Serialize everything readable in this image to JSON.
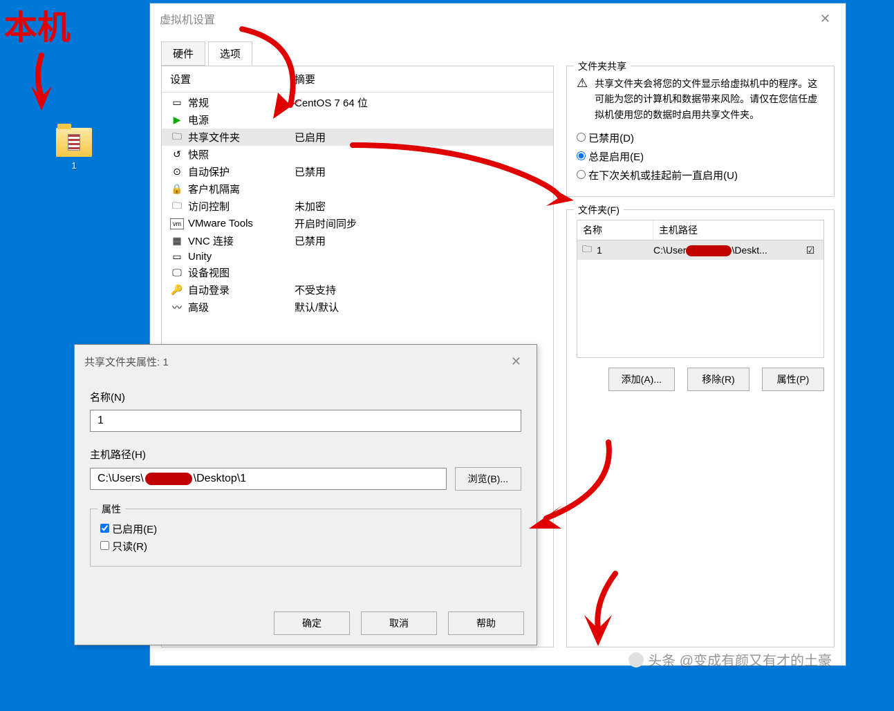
{
  "annotations": {
    "host_label": "本机"
  },
  "desktop": {
    "icon_label": "1"
  },
  "dialog": {
    "title": "虚拟机设置",
    "tabs": {
      "hardware": "硬件",
      "options": "选项"
    },
    "col_setting": "设置",
    "col_summary": "摘要",
    "rows": {
      "general": "常规",
      "general_summary": "CentOS 7 64 位",
      "power": "电源",
      "shared_folders": "共享文件夹",
      "shared_folders_summary": "已启用",
      "snapshots": "快照",
      "autoprotect": "自动保护",
      "autoprotect_summary": "已禁用",
      "guest_isolation": "客户机隔离",
      "access_control": "访问控制",
      "access_control_summary": "未加密",
      "vmware_tools": "VMware Tools",
      "vmware_tools_summary": "开启时间同步",
      "vnc": "VNC 连接",
      "vnc_summary": "已禁用",
      "unity": "Unity",
      "appliance_view": "设备视图",
      "autologin": "自动登录",
      "autologin_summary": "不受支持",
      "advanced": "高级",
      "advanced_summary": "默认/默认"
    }
  },
  "sharing": {
    "group_title": "文件夹共享",
    "warning": "共享文件夹会将您的文件显示给虚拟机中的程序。这可能为您的计算机和数据带来风险。请仅在您信任虚拟机使用您的数据时启用共享文件夹。",
    "radio_disabled": "已禁用(D)",
    "radio_always": "总是启用(E)",
    "radio_until": "在下次关机或挂起前一直启用(U)"
  },
  "folders": {
    "group_title": "文件夹(F)",
    "col_name": "名称",
    "col_host": "主机路径",
    "row_name": "1",
    "row_path_pre": "C:\\User",
    "row_path_post": "\\Deskt...",
    "btn_add": "添加(A)...",
    "btn_remove": "移除(R)",
    "btn_props": "属性(P)"
  },
  "props": {
    "title": "共享文件夹属性: 1",
    "name_label": "名称(N)",
    "name_value": "1",
    "host_label": "主机路径(H)",
    "host_pre": "C:\\Users\\",
    "host_post": "\\Desktop\\1",
    "browse": "浏览(B)...",
    "attrs_title": "属性",
    "enabled": "已启用(E)",
    "readonly": "只读(R)",
    "ok": "确定",
    "cancel": "取消",
    "help": "帮助"
  },
  "watermark": "头条 @变成有颜又有才的土豪"
}
